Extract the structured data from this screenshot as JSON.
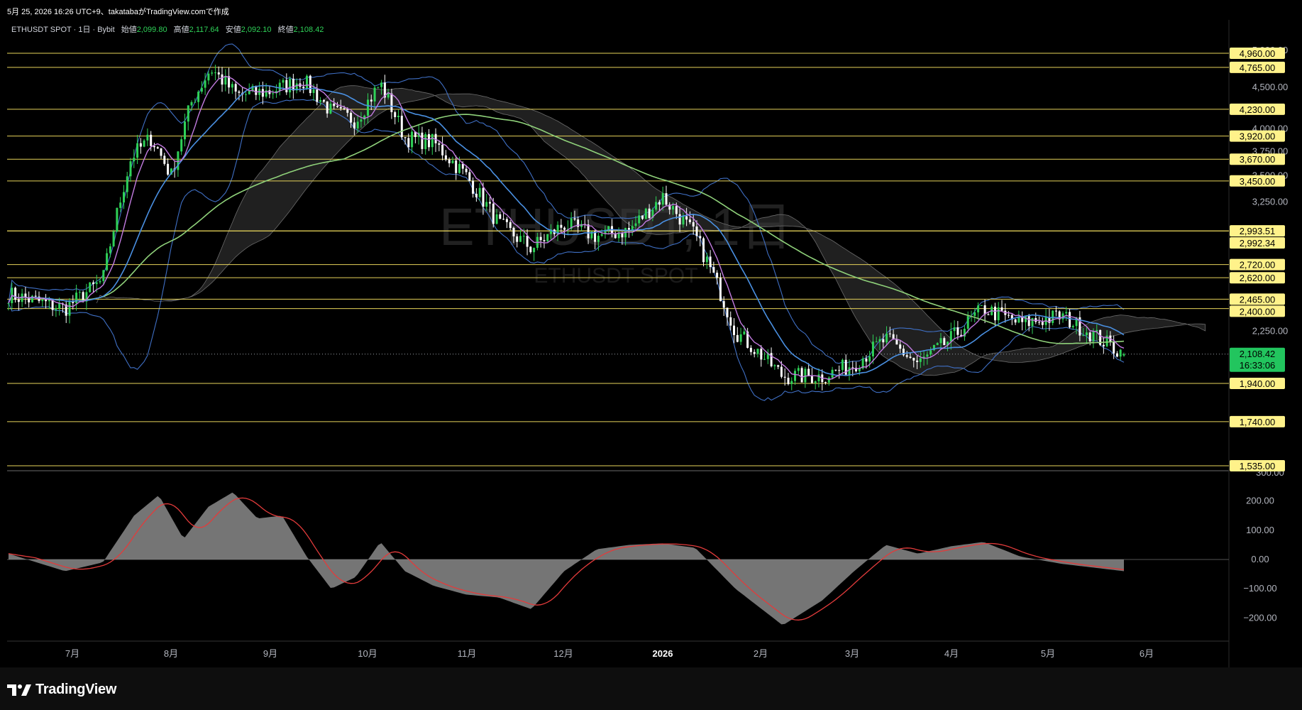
{
  "header": {
    "caption": "5月 25, 2026 16:26 UTC+9、takatabaがTradingView.comで作成"
  },
  "legend": {
    "symbol": "ETHUSDT SPOT · 1日 · Bybit",
    "open_label": "始値",
    "open": "2,099.80",
    "high_label": "高値",
    "high": "2,117.64",
    "low_label": "安値",
    "low": "2,092.10",
    "close_label": "終値",
    "close": "2,108.42"
  },
  "watermark": {
    "main": "ETHUSDT, 1日",
    "sub": "ETHUSDT SPOT"
  },
  "footer": {
    "brand": "TradingView"
  },
  "colors": {
    "background": "#000000",
    "up": "#2fd158",
    "down": "#ffffff",
    "level": "#e6d35a",
    "level_tag_bg": "#fff28a",
    "sma_fast": "#c27be0",
    "sma_mid": "#4a90e2",
    "sma_slow": "#8fd17a",
    "bollinger": "#3f6fc4",
    "cloud": "#3a3a3a",
    "macd_hist": "#8a8a8a",
    "macd_signal": "#e23b3b",
    "countdown_bg": "#22c55e"
  },
  "chart_data": [
    {
      "type": "candlestick",
      "name": "ETHUSDT SPOT 1日",
      "x_ticks": [
        "7月",
        "8月",
        "9月",
        "10月",
        "11月",
        "12月",
        "2026",
        "2月",
        "3月",
        "4月",
        "5月",
        "6月"
      ],
      "y_axis_scale": "log",
      "y_ticks": [
        "5,000.00",
        "4,500.00",
        "4,000.00",
        "3,750.00",
        "3,500.00",
        "3,250.00",
        "2,250.00",
        "300.00"
      ],
      "ylim": [
        1535,
        5000
      ],
      "horizontal_levels": [
        "4,960.00",
        "4,765.00",
        "4,230.00",
        "3,920.00",
        "3,670.00",
        "3,450.00",
        "2,993.51",
        "2,992.34",
        "2,720.00",
        "2,620.00",
        "2,465.00",
        "2,400.00",
        "1,940.00",
        "1,740.00",
        "1,535.00"
      ],
      "last_price": "2,108.42",
      "countdown": "16:33:06",
      "ohlc_last": {
        "open": 2099.8,
        "high": 2117.64,
        "low": 2092.1,
        "close": 2108.42
      },
      "close_path": [
        [
          "7月",
          2500
        ],
        [
          "7月",
          2400
        ],
        [
          "7月",
          2600
        ],
        [
          "8月",
          3700
        ],
        [
          "8月",
          3900
        ],
        [
          "8月",
          3500
        ],
        [
          "8月",
          4300
        ],
        [
          "8月",
          4750
        ],
        [
          "9月",
          4400
        ],
        [
          "9月",
          4450
        ],
        [
          "9月",
          4600
        ],
        [
          "10月",
          4200
        ],
        [
          "10月",
          4100
        ],
        [
          "10月",
          4550
        ],
        [
          "10月",
          3900
        ],
        [
          "11月",
          3850
        ],
        [
          "11月",
          3500
        ],
        [
          "11月",
          3050
        ],
        [
          "12月",
          2850
        ],
        [
          "12月",
          3050
        ],
        [
          "12月",
          2950
        ],
        [
          "2026",
          3000
        ],
        [
          "2026",
          3300
        ],
        [
          "2026",
          2950
        ],
        [
          "2月",
          2250
        ],
        [
          "2月",
          1980
        ],
        [
          "3月",
          1980
        ],
        [
          "3月",
          2050
        ],
        [
          "3月",
          2200
        ],
        [
          "4月",
          2050
        ],
        [
          "4月",
          2200
        ],
        [
          "4月",
          2400
        ],
        [
          "5月",
          2300
        ],
        [
          "5月",
          2350
        ],
        [
          "5月",
          2108.42
        ]
      ]
    },
    {
      "type": "bar",
      "name": "MACD",
      "y_ticks": [
        "200.00",
        "100.00",
        "0.00",
        "−100.00",
        "−200.00"
      ],
      "ylim": [
        -300,
        300
      ],
      "histogram_path": [
        [
          "7月",
          20
        ],
        [
          "7月",
          -40
        ],
        [
          "7月",
          -10
        ],
        [
          "8月",
          150
        ],
        [
          "8月",
          220
        ],
        [
          "8月",
          70
        ],
        [
          "8月",
          180
        ],
        [
          "9月",
          230
        ],
        [
          "9月",
          140
        ],
        [
          "9月",
          150
        ],
        [
          "9月",
          10
        ],
        [
          "10月",
          -100
        ],
        [
          "10月",
          -60
        ],
        [
          "10月",
          60
        ],
        [
          "10月",
          -40
        ],
        [
          "11月",
          -90
        ],
        [
          "11月",
          -120
        ],
        [
          "11月",
          -130
        ],
        [
          "12月",
          -170
        ],
        [
          "12月",
          -40
        ],
        [
          "12月",
          35
        ],
        [
          "2026",
          50
        ],
        [
          "2026",
          55
        ],
        [
          "2026",
          40
        ],
        [
          "2月",
          -100
        ],
        [
          "2月",
          -225
        ],
        [
          "3月",
          -140
        ],
        [
          "3月",
          -40
        ],
        [
          "3月",
          50
        ],
        [
          "4月",
          20
        ],
        [
          "4月",
          45
        ],
        [
          "4月",
          60
        ],
        [
          "5月",
          10
        ],
        [
          "5月",
          -15
        ],
        [
          "5月",
          -40
        ]
      ]
    }
  ]
}
